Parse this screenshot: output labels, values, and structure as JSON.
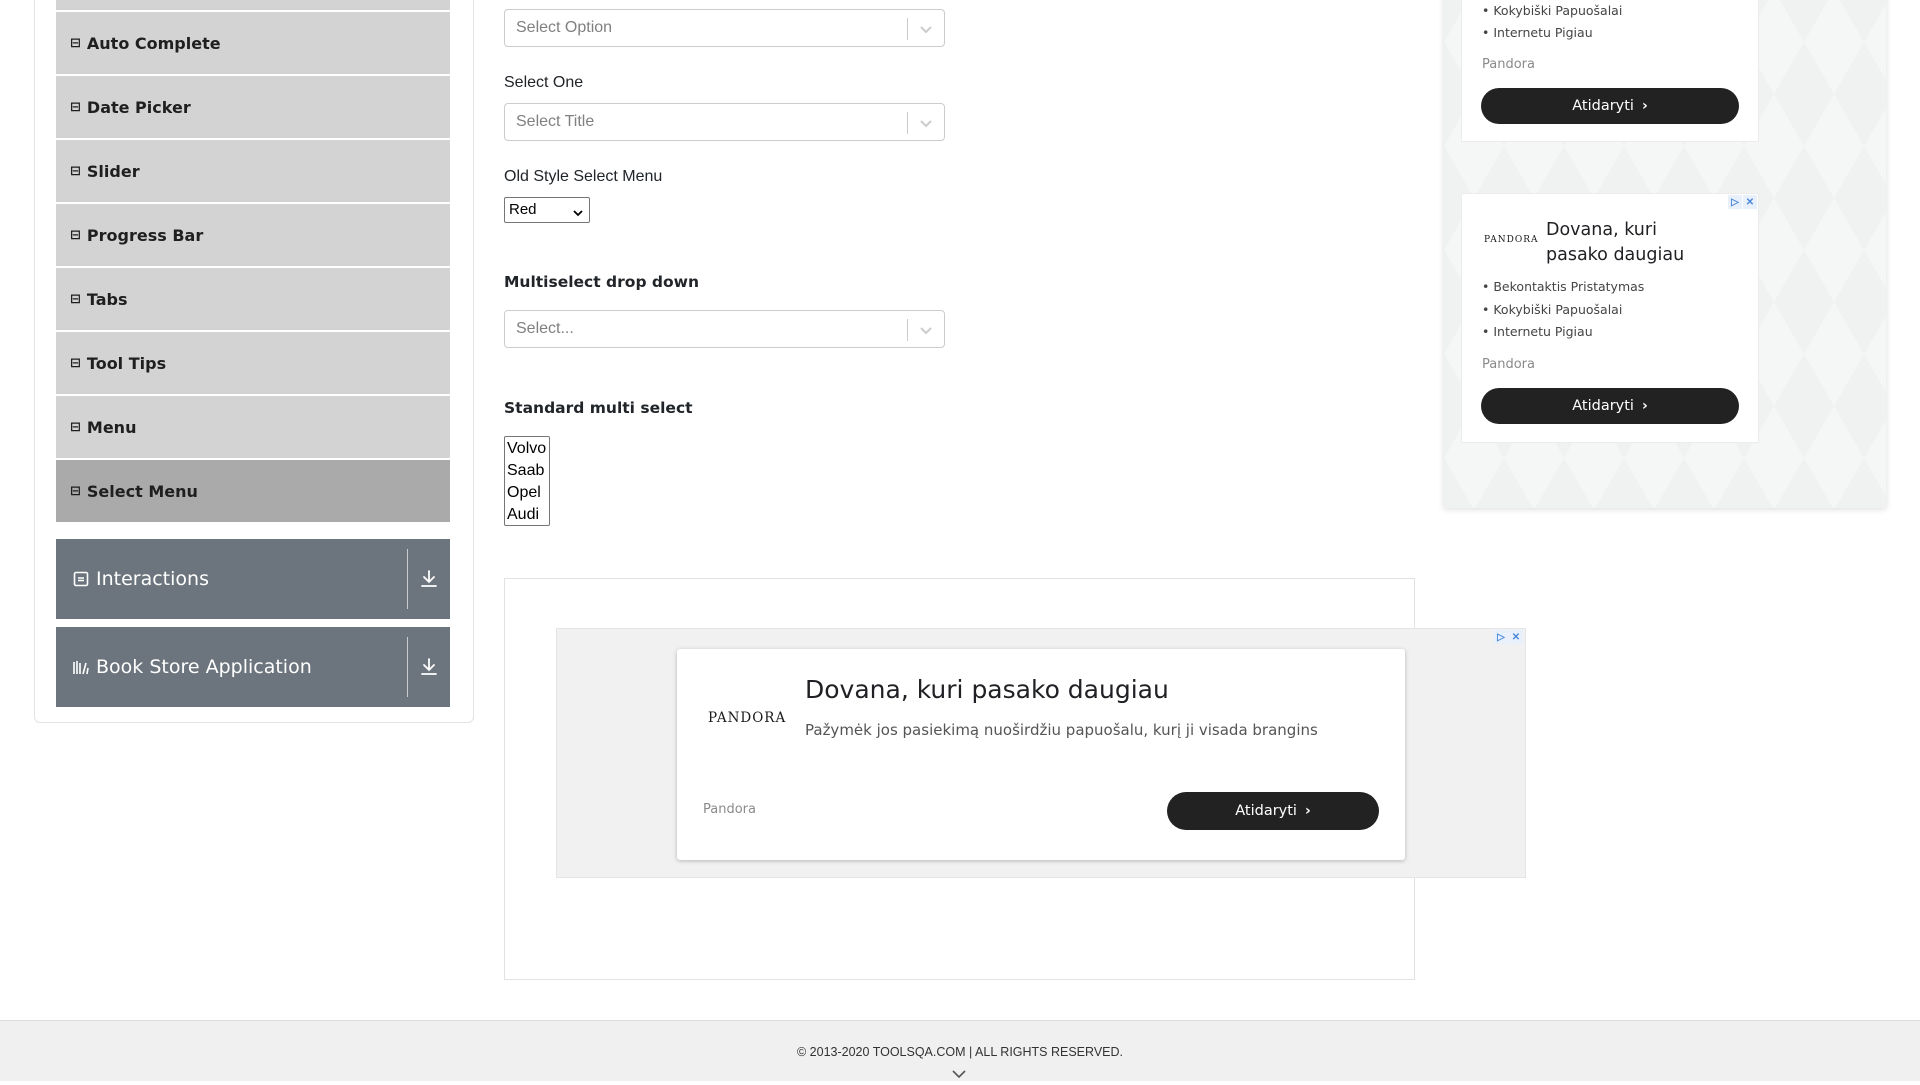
{
  "sidebar": {
    "elements_items": [
      {
        "label": "Auto Complete"
      },
      {
        "label": "Date Picker"
      },
      {
        "label": "Slider"
      },
      {
        "label": "Progress Bar"
      },
      {
        "label": "Tabs"
      },
      {
        "label": "Tool Tips"
      },
      {
        "label": "Menu"
      },
      {
        "label": "Select Menu",
        "active": true
      }
    ],
    "groups": [
      {
        "label": "Interactions",
        "icon": "interactions-icon"
      },
      {
        "label": "Book Store Application",
        "icon": "book-store-icon"
      }
    ]
  },
  "form": {
    "select_value": {
      "placeholder": "Select Option"
    },
    "select_one": {
      "label": "Select One",
      "placeholder": "Select Title"
    },
    "old_style": {
      "label": "Old Style Select Menu",
      "value": "Red"
    },
    "multiselect": {
      "label": "Multiselect drop down",
      "placeholder": "Select..."
    },
    "standard_multi": {
      "label": "Standard multi select",
      "options": [
        "Volvo",
        "Saab",
        "Opel",
        "Audi"
      ]
    }
  },
  "center_ad": {
    "logo": "PANDORA",
    "title": "Dovana, kuri pasako daugiau",
    "text": "Pažymėk jos pasiekimą nuoširdžiu papuošalu, kurį ji visada brangins",
    "brand": "Pandora",
    "button": "Atidaryti"
  },
  "right_ads": {
    "top": {
      "bullets": [
        "Kokybiški Papuošalai",
        "Internetu Pigiau"
      ],
      "brand": "Pandora",
      "button": "Atidaryti"
    },
    "second": {
      "logo": "PANDORA",
      "title_line1": "Dovana, kuri",
      "title_line2": "pasako daugiau",
      "bullets": [
        "Bekontaktis Pristatymas",
        "Kokybiški Papuošalai",
        "Internetu Pigiau"
      ],
      "brand": "Pandora",
      "button": "Atidaryti"
    }
  },
  "footer": {
    "copyright": "© 2013-2020 TOOLSQA.COM | ALL RIGHTS RESERVED."
  },
  "colors": {
    "menu_item_bg": "#d3d3d3",
    "menu_item_active_bg": "#aaaaaa",
    "group_header_bg": "#6c757d",
    "ad_button_bg": "#222222"
  }
}
